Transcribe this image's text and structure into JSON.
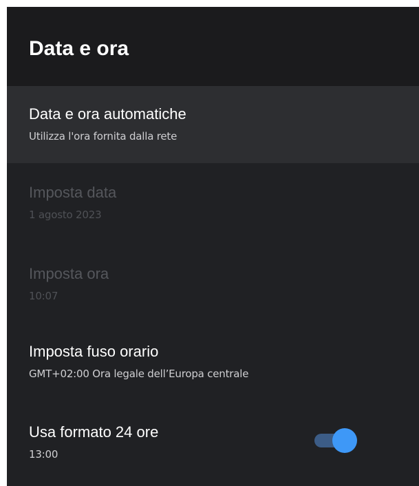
{
  "header": {
    "title": "Data e ora"
  },
  "items": [
    {
      "title": "Data e ora automatiche",
      "summary": "Utilizza l'ora fornita dalla rete",
      "state": "focused"
    },
    {
      "title": "Imposta data",
      "summary": "1 agosto 2023",
      "state": "disabled"
    },
    {
      "title": "Imposta ora",
      "summary": "10:07",
      "state": "disabled"
    },
    {
      "title": "Imposta fuso orario",
      "summary": "GMT+02:00 Ora legale dell’Europa centrale",
      "state": "enabled"
    },
    {
      "title": "Usa formato 24 ore",
      "summary": "13:00",
      "state": "enabled",
      "toggle_on": true
    }
  ],
  "colors": {
    "background": "#202124",
    "header_background": "#1b1b1d",
    "focused_background": "#2d2e31",
    "toggle_track": "#3c5c86",
    "toggle_thumb": "#3e98f7"
  }
}
